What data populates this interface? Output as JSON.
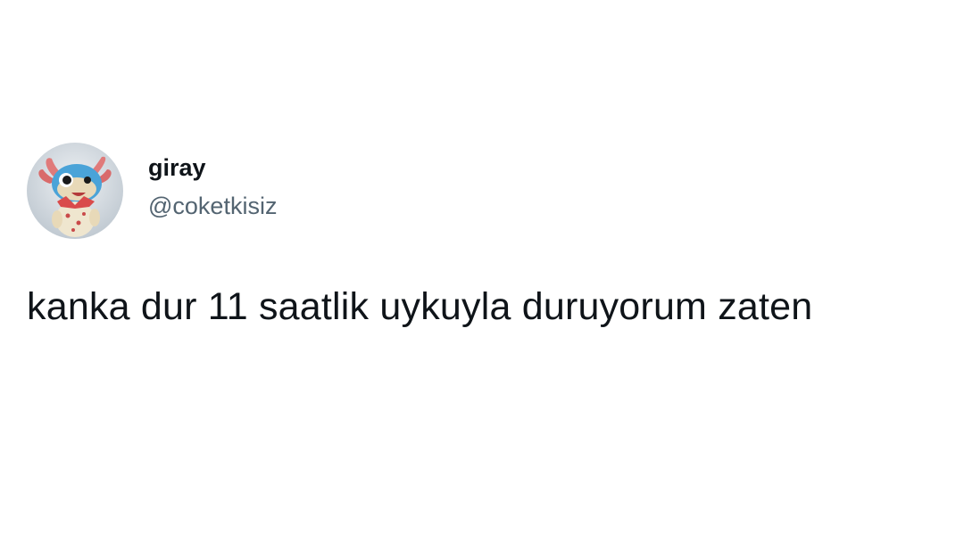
{
  "tweet": {
    "author": {
      "display_name": "giray",
      "handle": "@coketkisiz",
      "avatar_icon": "axolotl-avatar-icon"
    },
    "text": "kanka dur 11 saatlik uykuyla duruyorum zaten"
  },
  "colors": {
    "text_primary": "#0f1419",
    "text_secondary": "#536471",
    "background": "#ffffff"
  }
}
